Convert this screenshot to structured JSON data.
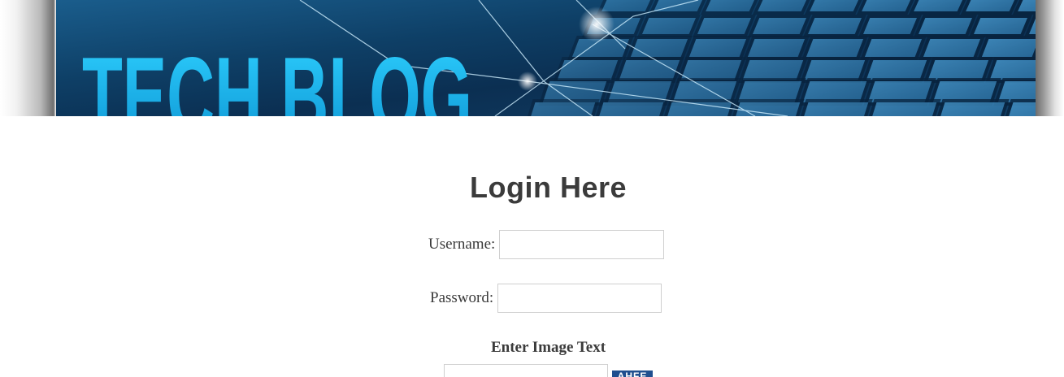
{
  "header": {
    "banner_text": "TECH BLOG"
  },
  "login": {
    "title": "Login Here",
    "username_label": "Username:",
    "username_value": "",
    "password_label": "Password:",
    "password_value": "",
    "captcha_label": "Enter Image Text",
    "captcha_value": "",
    "captcha_image_text": "AHFE"
  },
  "colors": {
    "banner_dark": "#0a2c4d",
    "banner_blue": "#2f7fb6",
    "title_cyan": "#1ab4ee",
    "heading_text": "#3b3b3b",
    "captcha_bg": "#1f4f8f"
  }
}
